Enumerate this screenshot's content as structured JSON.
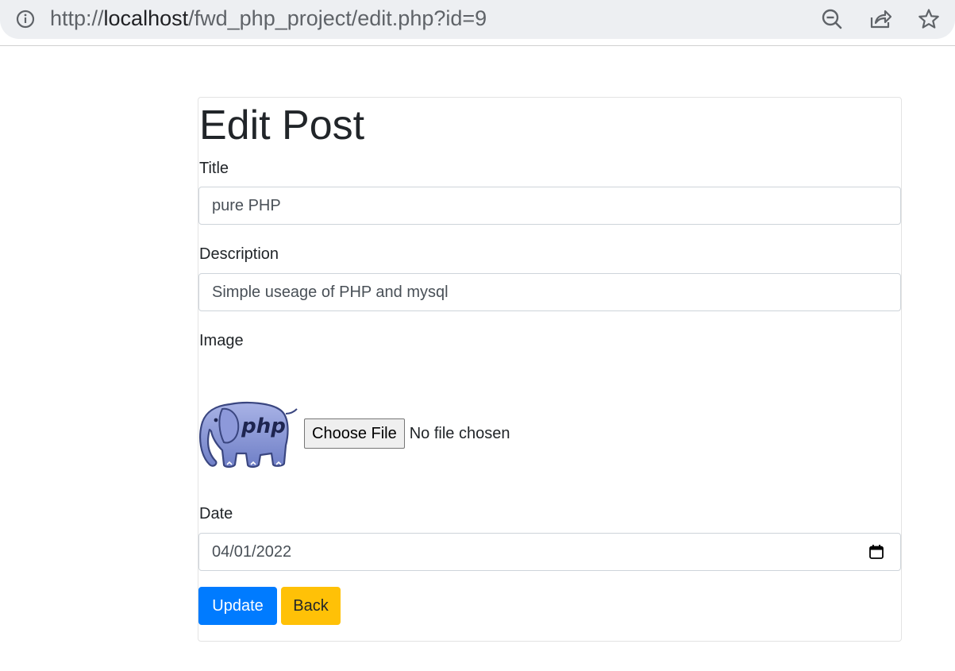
{
  "browser": {
    "url_scheme": "http://",
    "url_host": "localhost",
    "url_path": "/fwd_php_project/edit.php?id=9",
    "icons": [
      "info-icon",
      "zoom-out-icon",
      "share-icon",
      "bookmark-star-icon"
    ]
  },
  "page": {
    "title": "Edit Post"
  },
  "form": {
    "title_label": "Title",
    "title_value": "pure PHP",
    "description_label": "Description",
    "description_value": "Simple useage of PHP and mysql",
    "image_label": "Image",
    "image_alt": "php",
    "file_button_label": "Choose File",
    "file_status": "No file chosen",
    "date_label": "Date",
    "date_value": "04/01/2022"
  },
  "buttons": {
    "update_label": "Update",
    "back_label": "Back"
  },
  "colors": {
    "primary": "#007bff",
    "warning": "#ffc107",
    "omnibox": "#edeff2"
  }
}
